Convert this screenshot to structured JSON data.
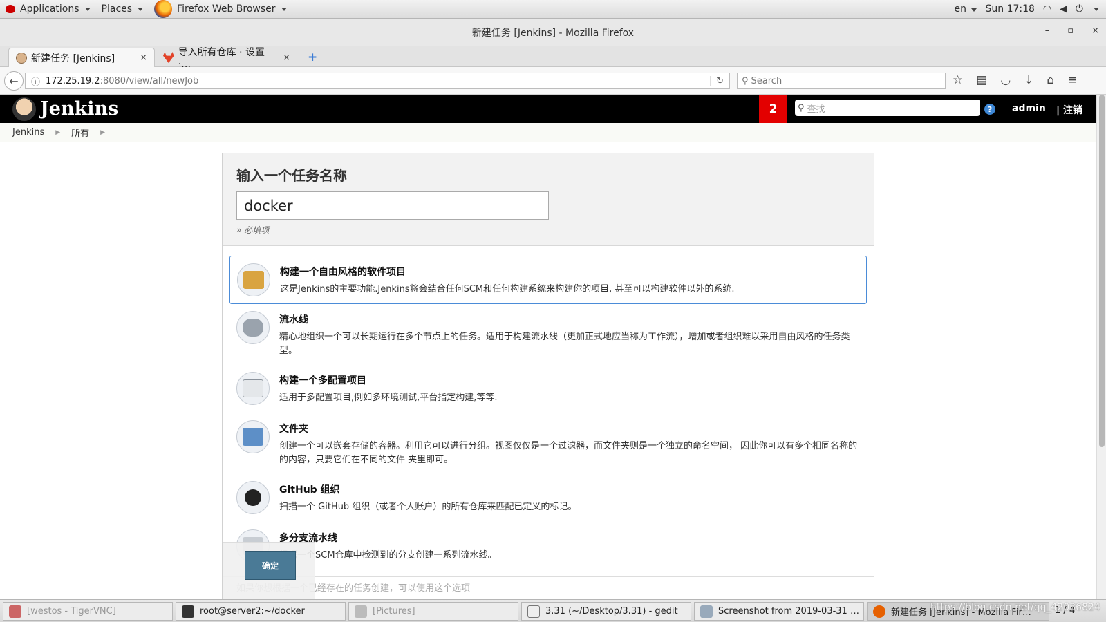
{
  "topbar": {
    "applications": "Applications",
    "places": "Places",
    "active_app": "Firefox Web Browser",
    "lang": "en",
    "clock": "Sun 17:18"
  },
  "window": {
    "title": "新建任务 [Jenkins] - Mozilla Firefox",
    "min": "–",
    "max": "▫",
    "close": "×"
  },
  "tabs": [
    {
      "label": "新建任务 [Jenkins]",
      "close": "×"
    },
    {
      "label": "导入所有仓库 · 设置 ·…",
      "close": "×"
    }
  ],
  "newtab": "+",
  "nav": {
    "url_host": "172.25.19.2",
    "url_path": ":8080/view/all/newJob",
    "search_placeholder": "Search"
  },
  "jenkins": {
    "title": "Jenkins",
    "badge": "2",
    "search_placeholder": "查找",
    "user": "admin",
    "logout": "| 注销"
  },
  "breadcrumb": [
    "Jenkins",
    "所有"
  ],
  "form": {
    "heading": "输入一个任务名称",
    "name_value": "docker",
    "required_note": "» 必填项",
    "ok_label": "确定",
    "footer_text": "如果你想根据一个已经存在的任务创建，可以使用这个选项"
  },
  "items": [
    {
      "title": "构建一个自由风格的软件项目",
      "desc": "这是Jenkins的主要功能.Jenkins将会结合任何SCM和任何构建系统来构建你的项目, 甚至可以构建软件以外的系统."
    },
    {
      "title": "流水线",
      "desc": "精心地组织一个可以长期运行在多个节点上的任务。适用于构建流水线（更加正式地应当称为工作流），增加或者组织难以采用自由风格的任务类型。"
    },
    {
      "title": "构建一个多配置项目",
      "desc": "适用于多配置项目,例如多环境测试,平台指定构建,等等."
    },
    {
      "title": "文件夹",
      "desc": "创建一个可以嵌套存储的容器。利用它可以进行分组。视图仅仅是一个过滤器，而文件夹则是一个独立的命名空间， 因此你可以有多个相同名称的的内容，只要它们在不同的文件 夹里即可。"
    },
    {
      "title": "GitHub 组织",
      "desc": "扫描一个 GitHub 组织（或者个人账户）的所有仓库来匹配已定义的标记。"
    },
    {
      "title": "多分支流水线",
      "desc": "根据一个SCM仓库中检测到的分支创建一系列流水线。"
    }
  ],
  "taskbar": [
    {
      "label": "[westos - TigerVNC]"
    },
    {
      "label": "root@server2:~/docker"
    },
    {
      "label": "[Pictures]"
    },
    {
      "label": "3.31 (~/Desktop/3.31) - gedit"
    },
    {
      "label": "Screenshot from 2019-03-31 …"
    },
    {
      "label": "新建任务 [Jenkins] - Mozilla Fir…"
    }
  ],
  "pager": "1 / 4",
  "watermark": "https://blog.csdn.net/qq_42036824",
  "colors": {
    "jenkins_header": "#000000",
    "badge": "#e30000",
    "selected_border": "#4b8cd8",
    "ok_button": "#4a7a96"
  }
}
